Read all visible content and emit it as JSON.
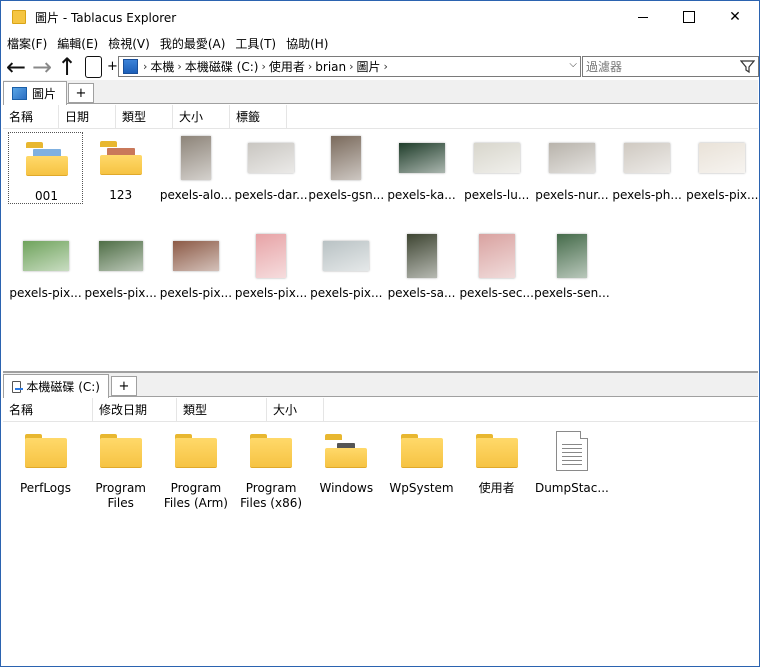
{
  "window": {
    "title": "圖片 - Tablacus Explorer",
    "close_glyph": "✕"
  },
  "menu": [
    "檔案(F)",
    "編輯(E)",
    "檢視(V)",
    "我的最愛(A)",
    "工具(T)",
    "協助(H)"
  ],
  "toolbar": {
    "back_glyph": "←",
    "forward_glyph": "→",
    "up_glyph": "↑",
    "plus_glyph": "+",
    "breadcrumbs": [
      "本機",
      "本機磁碟 (C:)",
      "使用者",
      "brian",
      "圖片"
    ],
    "separator": "›",
    "dropdown_glyph": "⌵",
    "filter_placeholder": "過濾器"
  },
  "top_pane": {
    "tab_label": "圖片",
    "add_tab": "+",
    "columns": [
      "名稱",
      "日期",
      "類型",
      "大小",
      "標籤"
    ],
    "items": [
      {
        "label": "001",
        "kind": "folder",
        "peek": "#7fb0e0"
      },
      {
        "label": "123",
        "kind": "folder",
        "peek": "#c9785a"
      },
      {
        "label": "pexels-alo...",
        "kind": "photo",
        "color": "#8d8479"
      },
      {
        "label": "pexels-dar...",
        "kind": "photo",
        "color": "#c9c6c1"
      },
      {
        "label": "pexels-gsn...",
        "kind": "photo",
        "color": "#7a6a5c"
      },
      {
        "label": "pexels-ka...",
        "kind": "photo",
        "color": "#1f3d2a"
      },
      {
        "label": "pexels-lu...",
        "kind": "photo",
        "color": "#d8d6cc"
      },
      {
        "label": "pexels-nur...",
        "kind": "photo",
        "color": "#b8b3ab"
      },
      {
        "label": "pexels-ph...",
        "kind": "photo",
        "color": "#cfc9c1"
      },
      {
        "label": "pexels-pix...",
        "kind": "photo",
        "color": "#e9e2d8"
      },
      {
        "label": "pexels-pix...",
        "kind": "photo",
        "color": "#6fa35c"
      },
      {
        "label": "pexels-pix...",
        "kind": "photo",
        "color": "#4f6e46"
      },
      {
        "label": "pexels-pix...",
        "kind": "photo",
        "color": "#8c5a46"
      },
      {
        "label": "pexels-pix...",
        "kind": "photo",
        "color": "#e7a3a6"
      },
      {
        "label": "pexels-pix...",
        "kind": "photo",
        "color": "#b9c2c4"
      },
      {
        "label": "pexels-sa...",
        "kind": "photo",
        "color": "#3e4532"
      },
      {
        "label": "pexels-sec...",
        "kind": "photo",
        "color": "#d9a2a0"
      },
      {
        "label": "pexels-sen...",
        "kind": "photo",
        "color": "#456b4a"
      }
    ]
  },
  "bottom_pane": {
    "tab_label": "本機磁碟 (C:)",
    "add_tab": "+",
    "columns": [
      "名稱",
      "修改日期",
      "類型",
      "大小"
    ],
    "items": [
      {
        "label": "PerfLogs",
        "kind": "folder"
      },
      {
        "label": "Program Files",
        "kind": "folder"
      },
      {
        "label": "Program Files (Arm)",
        "kind": "folder"
      },
      {
        "label": "Program Files (x86)",
        "kind": "folder"
      },
      {
        "label": "Windows",
        "kind": "folder-windows"
      },
      {
        "label": "WpSystem",
        "kind": "folder"
      },
      {
        "label": "使用者",
        "kind": "folder"
      },
      {
        "label": "DumpStac...",
        "kind": "file"
      }
    ]
  }
}
